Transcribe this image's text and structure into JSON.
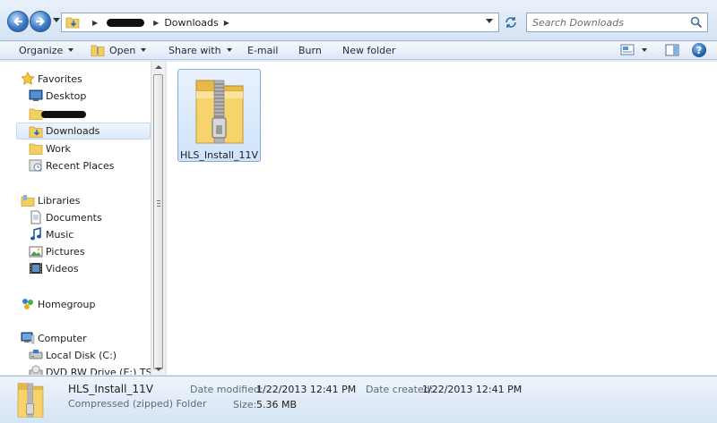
{
  "address_bar": {
    "back_icon": "back-arrow-icon",
    "forward_icon": "forward-arrow-icon",
    "breadcrumb": {
      "current_folder": "Downloads"
    },
    "search_placeholder": "Search Downloads"
  },
  "toolbar": {
    "organize": "Organize",
    "open": "Open",
    "share_with": "Share with",
    "email": "E-mail",
    "burn": "Burn",
    "new_folder": "New folder",
    "help": "?"
  },
  "sidebar": {
    "favorites_header": "Favorites",
    "favorites": [
      {
        "label": "Desktop",
        "icon": "desktop-icon"
      },
      {
        "label": "",
        "icon": "folder-icon",
        "redacted": true
      },
      {
        "label": "Downloads",
        "icon": "downloads-folder-icon",
        "selected": true
      },
      {
        "label": "Work",
        "icon": "folder-icon"
      },
      {
        "label": "Recent Places",
        "icon": "recent-places-icon"
      }
    ],
    "libraries_header": "Libraries",
    "libraries": [
      {
        "label": "Documents",
        "icon": "documents-icon"
      },
      {
        "label": "Music",
        "icon": "music-icon"
      },
      {
        "label": "Pictures",
        "icon": "pictures-icon"
      },
      {
        "label": "Videos",
        "icon": "videos-icon"
      }
    ],
    "homegroup": "Homegroup",
    "computer_header": "Computer",
    "computer": [
      {
        "label": "Local Disk (C:)",
        "icon": "hard-drive-icon"
      },
      {
        "label": "DVD RW Drive (E:) TSSY",
        "icon": "dvd-drive-icon"
      }
    ]
  },
  "files": [
    {
      "name": "HLS_Install_11V",
      "icon": "zip-folder-icon",
      "selected": true
    }
  ],
  "details": {
    "name": "HLS_Install_11V",
    "type": "Compressed (zipped) Folder",
    "date_modified_label": "Date modified:",
    "date_modified": "1/22/2013 12:41 PM",
    "date_created_label": "Date created:",
    "date_created": "1/22/2013 12:41 PM",
    "size_label": "Size:",
    "size": "5.36 MB"
  },
  "colors": {
    "chrome_light": "#e9f1fb",
    "chrome_dark": "#d5e3f3",
    "selection_fill": "#cfe3fb",
    "selection_border": "#84acdd",
    "folder_yellow": "#f3cf5c"
  }
}
